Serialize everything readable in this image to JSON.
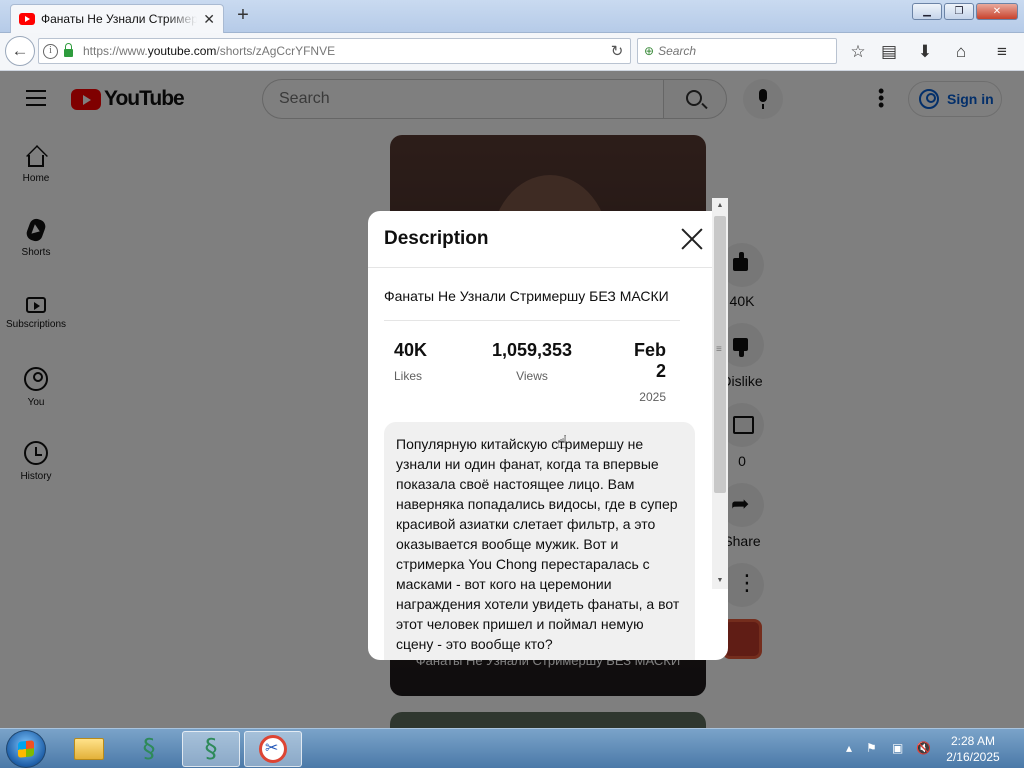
{
  "browser": {
    "tab_title": "Фанаты Не Узнали Стримершу БЕЗ МАСКИ",
    "tab_close": "✕",
    "new_tab": "+",
    "window_controls": {
      "minimize": "▁",
      "restore": "❐",
      "close": "✕"
    },
    "url_prefix": "https://www.",
    "url_domain": "youtube.com",
    "url_path": "/shorts/zAgCcrYFNVE",
    "reload": "↻",
    "search_placeholder": "Search",
    "icons": [
      "back-arrow-icon",
      "info-icon",
      "lock-icon",
      "reload-icon",
      "bookmark-star-icon",
      "reading-list-icon",
      "download-icon",
      "home-icon",
      "hamburger-menu-icon"
    ]
  },
  "youtube": {
    "logo_text": "YouTube",
    "search_placeholder": "Search",
    "sign_in": "Sign in",
    "sidebar": [
      {
        "label": "Home",
        "icon": "home-icon"
      },
      {
        "label": "Shorts",
        "icon": "shorts-icon"
      },
      {
        "label": "Subscriptions",
        "icon": "subscriptions-icon"
      },
      {
        "label": "You",
        "icon": "you-icon"
      },
      {
        "label": "History",
        "icon": "history-icon"
      }
    ],
    "video_caption": "Фанаты Не Узнали Стримершу БЕЗ МАСКИ",
    "actions": {
      "like_count": "40K",
      "dislike_label": "Dislike",
      "comments_count": "0",
      "share_label": "Share"
    }
  },
  "modal": {
    "title": "Description",
    "video_title": "Фанаты Не Узнали Стримершу БЕЗ МАСКИ",
    "likes_value": "40K",
    "likes_label": "Likes",
    "views_value": "1,059,353",
    "views_label": "Views",
    "date_value": "Feb 2",
    "date_year": "2025",
    "description": "Популярную китайскую стримершу не узнали ни один фанат, когда та впервые показала своё настоящее лицо. Вам наверняка попадались видосы, где в супер красивой азиатки слетает фильтр, а это оказывается вообще мужик. Вот и стримерка You Chong перестаралась с масками - вот кого на церемонии награждения хотели увидеть фанаты, а вот этот человек пришел и поймал немую сцену - это вообще кто?\n\nИнстаграм - https://www.instagram.com"
  },
  "taskbar": {
    "time": "2:28 AM",
    "date": "2/16/2025",
    "apps": [
      "windows-explorer-icon",
      "dragon-app-icon",
      "dragon-app-active-icon",
      "snipping-tool-icon"
    ],
    "tray_icons": [
      "show-hidden-icons-icon",
      "action-center-flag-icon",
      "network-icon",
      "volume-muted-icon"
    ]
  }
}
